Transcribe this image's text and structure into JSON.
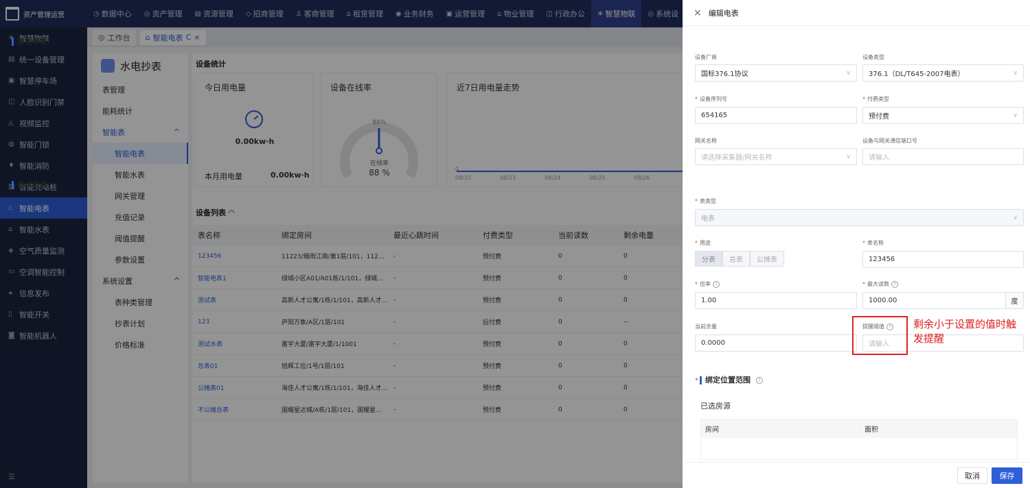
{
  "header": {
    "logo_text": "资产管理运营",
    "nav": [
      {
        "icon": "◷",
        "label": "数据中心"
      },
      {
        "icon": "◎",
        "label": "资产管理"
      },
      {
        "icon": "▤",
        "label": "资源管理"
      },
      {
        "icon": "◇",
        "label": "招商管理"
      },
      {
        "icon": "♙",
        "label": "客商管理"
      },
      {
        "icon": "⌂",
        "label": "租赁管理"
      },
      {
        "icon": "◉",
        "label": "业务财务"
      },
      {
        "icon": "▣",
        "label": "运营管理"
      },
      {
        "icon": "⌂",
        "label": "物业管理"
      },
      {
        "icon": "◫",
        "label": "行政办公"
      },
      {
        "icon": "✳",
        "label": "智慧物联"
      },
      {
        "icon": "◎",
        "label": "系统设"
      }
    ]
  },
  "sidebar": {
    "items": [
      {
        "icon": "✳",
        "label": "智慧物联"
      },
      {
        "icon": "▤",
        "label": "统一设备管理"
      },
      {
        "icon": "▣",
        "label": "智慧停车场"
      },
      {
        "icon": "◫",
        "label": "人脸识别门禁"
      },
      {
        "icon": "◬",
        "label": "视频监控"
      },
      {
        "icon": "◍",
        "label": "智能门锁"
      },
      {
        "icon": "♦",
        "label": "智能消防"
      },
      {
        "icon": "▥",
        "label": "智能充电桩"
      },
      {
        "icon": "⌂",
        "label": "智能电表"
      },
      {
        "icon": "⌂",
        "label": "智能水表"
      },
      {
        "icon": "◈",
        "label": "空气质量监测"
      },
      {
        "icon": "▭",
        "label": "空调智能控制"
      },
      {
        "icon": "◂",
        "label": "信息发布"
      },
      {
        "icon": "▯",
        "label": "智能开关"
      },
      {
        "icon": "◙",
        "label": "智能机器人"
      }
    ],
    "bottom_icon": "☰"
  },
  "tabs": [
    {
      "label": "工作台",
      "icon": "◎"
    },
    {
      "label": "智能电表",
      "icon": "⌂",
      "refresh": "C",
      "close": "×"
    }
  ],
  "subnav": {
    "title": "水电抄表",
    "items": [
      {
        "label": "表管理",
        "type": "top"
      },
      {
        "label": "能耗统计",
        "type": "top"
      },
      {
        "label": "智能表",
        "type": "group",
        "caret": "^"
      },
      {
        "label": "智能电表",
        "type": "sel"
      },
      {
        "label": "智能水表",
        "type": "child"
      },
      {
        "label": "网关管理",
        "type": "child"
      },
      {
        "label": "充值记录",
        "type": "child"
      },
      {
        "label": "阈值提醒",
        "type": "child"
      },
      {
        "label": "参数设置",
        "type": "child"
      },
      {
        "label": "系统设置",
        "type": "top",
        "caret": "^"
      },
      {
        "label": "表种类管理",
        "type": "child"
      },
      {
        "label": "抄表计划",
        "type": "child"
      },
      {
        "label": "价格标准",
        "type": "child"
      }
    ]
  },
  "main": {
    "stats_title": "设备统计",
    "today": {
      "title": "今日用电量",
      "value": "0.00kw·h",
      "month_label": "本月用电量",
      "month_value": "0.00kw·h"
    },
    "online": {
      "title": "设备在线率",
      "pct": "88%",
      "label": "在线率",
      "value": "88 %",
      "rate": 0.88
    },
    "trend": {
      "title": "近7日用电量走势",
      "zero": "0",
      "dates": [
        "08/22",
        "08/23",
        "08/24",
        "08/25",
        "08/26"
      ]
    },
    "list_title": "设备列表",
    "columns": [
      "表名称",
      "绑定房间",
      "最近心跳时间",
      "付费类型",
      "当前读数",
      "剩余电量"
    ],
    "rows": [
      [
        "123456",
        "11223/烟雨江南/第1层/101，11223/烟...",
        "-",
        "预付费",
        "0",
        "0"
      ],
      [
        "智能电表1",
        "绿城小区A01/A01栋/1/101，绿城小区...",
        "-",
        "预付费",
        "0",
        "0"
      ],
      [
        "测试表",
        "高新人才公寓/1栋/1/101，高新人才公...",
        "-",
        "预付费",
        "0",
        "0"
      ],
      [
        "123",
        "庐阳万象/A区/1层/101",
        "-",
        "后付费",
        "0",
        "--"
      ],
      [
        "测试水表",
        "富宇大厦/富宇大厦/1/1001",
        "-",
        "预付费",
        "0",
        "0"
      ],
      [
        "总表01",
        "旭辉工位/1号/1层/101",
        "-",
        "预付费",
        "0",
        "0"
      ],
      [
        "公摊表01",
        "海佳人才公寓/1栋/1/101，海佳人才公...",
        "-",
        "预付费",
        "0",
        "0"
      ],
      [
        "不公摊总表",
        "国耀星达城/A栋/1层/101，国耀星达城...",
        "-",
        "预付费",
        "0",
        "0"
      ]
    ]
  },
  "drawer": {
    "close": "×",
    "title": "编辑电表",
    "sec_smart": "智能参数",
    "vendor_label": "设备厂商",
    "vendor_value": "国标376.1协议",
    "devtype_label": "设备类型",
    "devtype_value": "376.1（DL/T645-2007电表）",
    "serial_label": "设备序列号",
    "serial_value": "654165",
    "pay_label": "付费类型",
    "pay_value": "预付费",
    "gateway_label": "网关名称",
    "gateway_placeholder": "请选择采集器/网关名称",
    "port_label": "设备与网关通信端口号",
    "port_placeholder": "请输入",
    "sec_basic": "基本信息",
    "metertype_label": "表类型",
    "metertype_value": "电表",
    "usage_label": "用途",
    "usage_options": [
      "分表",
      "总表",
      "公摊表"
    ],
    "name_label": "表名称",
    "name_value": "123456",
    "rate_label": "倍率",
    "rate_value": "1.00",
    "max_label": "最大读数",
    "max_value": "1000.00",
    "max_unit": "度",
    "balance_label": "当前余量",
    "balance_value": "0.0000",
    "threshold_label": "提醒阈值",
    "threshold_placeholder": "请输入",
    "annotation": "剩余小于设置的值时触发提醒",
    "sec_bind": "绑定位置范围",
    "selected_label": "已选房源",
    "room_col": "房间",
    "area_col": "面积",
    "cancel": "取消",
    "save": "保存"
  }
}
